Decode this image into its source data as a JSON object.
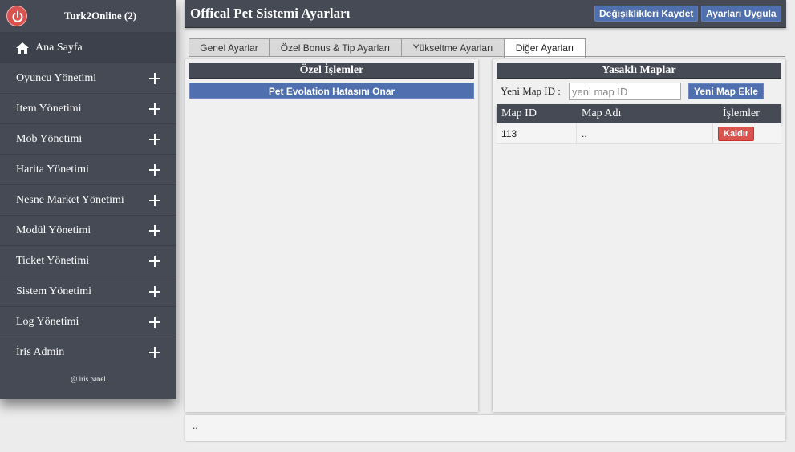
{
  "sidebar": {
    "brand": "Turk2Online (2)",
    "home_label": "Ana Sayfa",
    "items": [
      {
        "label": "Oyuncu Yönetimi"
      },
      {
        "label": "İtem Yönetimi"
      },
      {
        "label": "Mob Yönetimi"
      },
      {
        "label": "Harita Yönetimi"
      },
      {
        "label": "Nesne Market Yönetimi"
      },
      {
        "label": "Modül Yönetimi"
      },
      {
        "label": "Ticket Yönetimi"
      },
      {
        "label": "Sistem Yönetimi"
      },
      {
        "label": "Log Yönetimi"
      },
      {
        "label": "İris Admin"
      }
    ],
    "footer": "@ iris panel"
  },
  "header": {
    "title": "Offical Pet Sistemi Ayarları",
    "save_label": "Değişiklikleri Kaydet",
    "apply_label": "Ayarları Uygula"
  },
  "tabs": [
    {
      "label": "Genel Ayarlar"
    },
    {
      "label": "Özel Bonus & Tip Ayarları"
    },
    {
      "label": "Yükseltme Ayarları"
    },
    {
      "label": "Diğer Ayarları"
    }
  ],
  "left_panel": {
    "title": "Özel İşlemler",
    "button_label": "Pet Evolation Hatasını Onar"
  },
  "right_panel": {
    "title": "Yasaklı Maplar",
    "input_label": "Yeni Map ID :",
    "input_placeholder": "yeni map ID",
    "input_value": "",
    "add_label": "Yeni Map Ekle",
    "columns": [
      "Map ID",
      "Map Adı",
      "İşlemler"
    ],
    "rows": [
      {
        "map_id": "113",
        "map_name": "..",
        "action": "Kaldır"
      }
    ]
  },
  "footer": {
    "text": ".."
  },
  "colors": {
    "dark": "#464a55",
    "accent": "#4f6fae",
    "danger": "#d9534f",
    "power": "#d9534f"
  }
}
